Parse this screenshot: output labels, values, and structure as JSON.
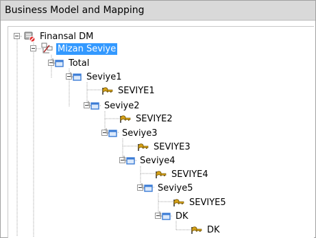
{
  "window": {
    "title": "Business Model and Mapping"
  },
  "tree": {
    "root": {
      "label": "Finansal DM",
      "icon": "database-model-icon"
    },
    "model": {
      "label": "Mizan Seviye",
      "icon": "hierarchy-model-icon",
      "selected": true
    },
    "levels": [
      {
        "label": "Total",
        "icon": "level-icon"
      },
      {
        "label": "Seviye1",
        "icon": "level-icon"
      },
      {
        "label": "SEVIYE1",
        "icon": "key-column-icon"
      },
      {
        "label": "Seviye2",
        "icon": "level-icon"
      },
      {
        "label": "SEVIYE2",
        "icon": "key-column-icon"
      },
      {
        "label": "Seviye3",
        "icon": "level-icon"
      },
      {
        "label": "SEVIYE3",
        "icon": "key-column-icon"
      },
      {
        "label": "Seviye4",
        "icon": "level-icon"
      },
      {
        "label": "SEVIYE4",
        "icon": "key-column-icon"
      },
      {
        "label": "Seviye5",
        "icon": "level-icon"
      },
      {
        "label": "SEVIYE5",
        "icon": "key-column-icon"
      },
      {
        "label": "DK",
        "icon": "level-icon"
      },
      {
        "label": "DK",
        "icon": "key-column-icon"
      }
    ]
  },
  "colors": {
    "selection": "#3399ff",
    "titlebar": "#d9d9d9",
    "level_icon": "#3a7bd5",
    "key_icon": "#d4a017"
  }
}
